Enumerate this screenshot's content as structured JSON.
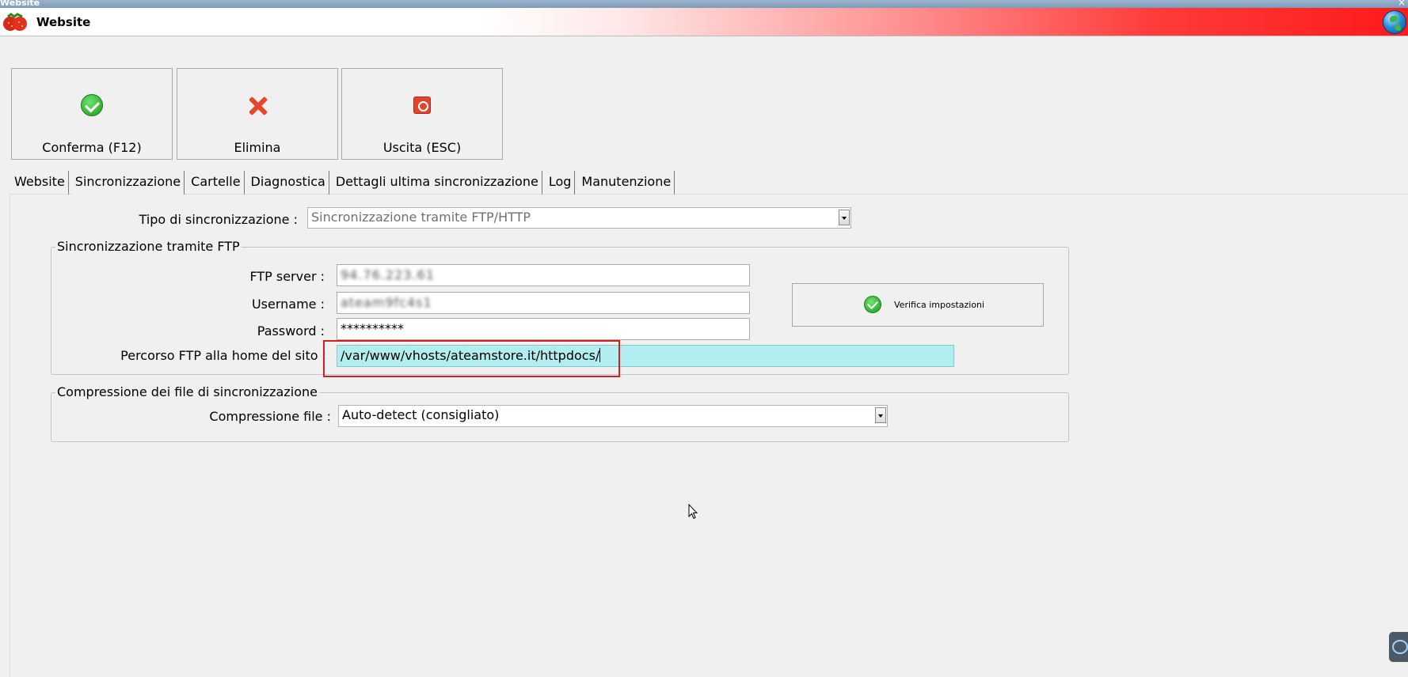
{
  "window": {
    "title": "Website"
  },
  "header": {
    "title": "Website"
  },
  "toolbar": {
    "confirm_label": "Conferma (F12)",
    "delete_label": "Elimina",
    "exit_label": "Uscita (ESC)"
  },
  "tabs": [
    {
      "label": "Website"
    },
    {
      "label": "Sincronizzazione",
      "active": true
    },
    {
      "label": "Cartelle"
    },
    {
      "label": "Diagnostica"
    },
    {
      "label": "Dettagli ultima sincronizzazione"
    },
    {
      "label": "Log"
    },
    {
      "label": "Manutenzione"
    }
  ],
  "sync": {
    "type_label": "Tipo di sincronizzazione :",
    "type_value": "Sincronizzazione tramite FTP/HTTP"
  },
  "ftp": {
    "group_title": "Sincronizzazione tramite FTP",
    "server_label": "FTP server :",
    "server_value": "94.76.223.61",
    "username_label": "Username :",
    "username_value": "ateam9fc4s1",
    "password_label": "Password :",
    "password_value": "**********",
    "path_label": "Percorso FTP alla home del sito :",
    "path_value": "/var/www/vhosts/ateamstore.it/httpdocs/",
    "verify_label": "Verifica impostazioni"
  },
  "compression": {
    "group_title": "Compressione dei file di sincronizzazione",
    "file_label": "Compressione file :",
    "file_value": "Auto-detect (consigliato)"
  },
  "icons": {
    "confirm": "check-circle-icon",
    "delete": "red-x-icon",
    "exit": "power-icon",
    "verify": "check-circle-icon",
    "app": "strawberry-logo-icon",
    "globe": "globe-icon"
  },
  "colors": {
    "header_gradient_end": "#ff1a1a",
    "highlight_field": "#b2eef0",
    "annotation_box": "#d21f1f"
  }
}
